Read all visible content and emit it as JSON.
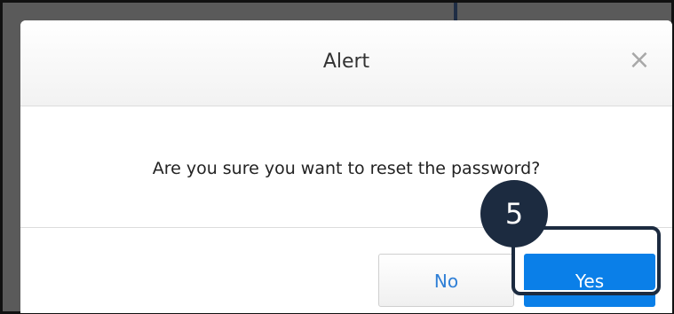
{
  "dialog": {
    "title": "Alert",
    "close_glyph": "×",
    "close_icon": "close-icon",
    "message": "Are you sure you want to reset the password?",
    "no_label": "No",
    "yes_label": "Yes"
  },
  "annotation": {
    "step_number": "5"
  },
  "colors": {
    "primary": "#0a7fe8",
    "secondary_text": "#2f7fd6",
    "annotation": "#1c2b40"
  }
}
